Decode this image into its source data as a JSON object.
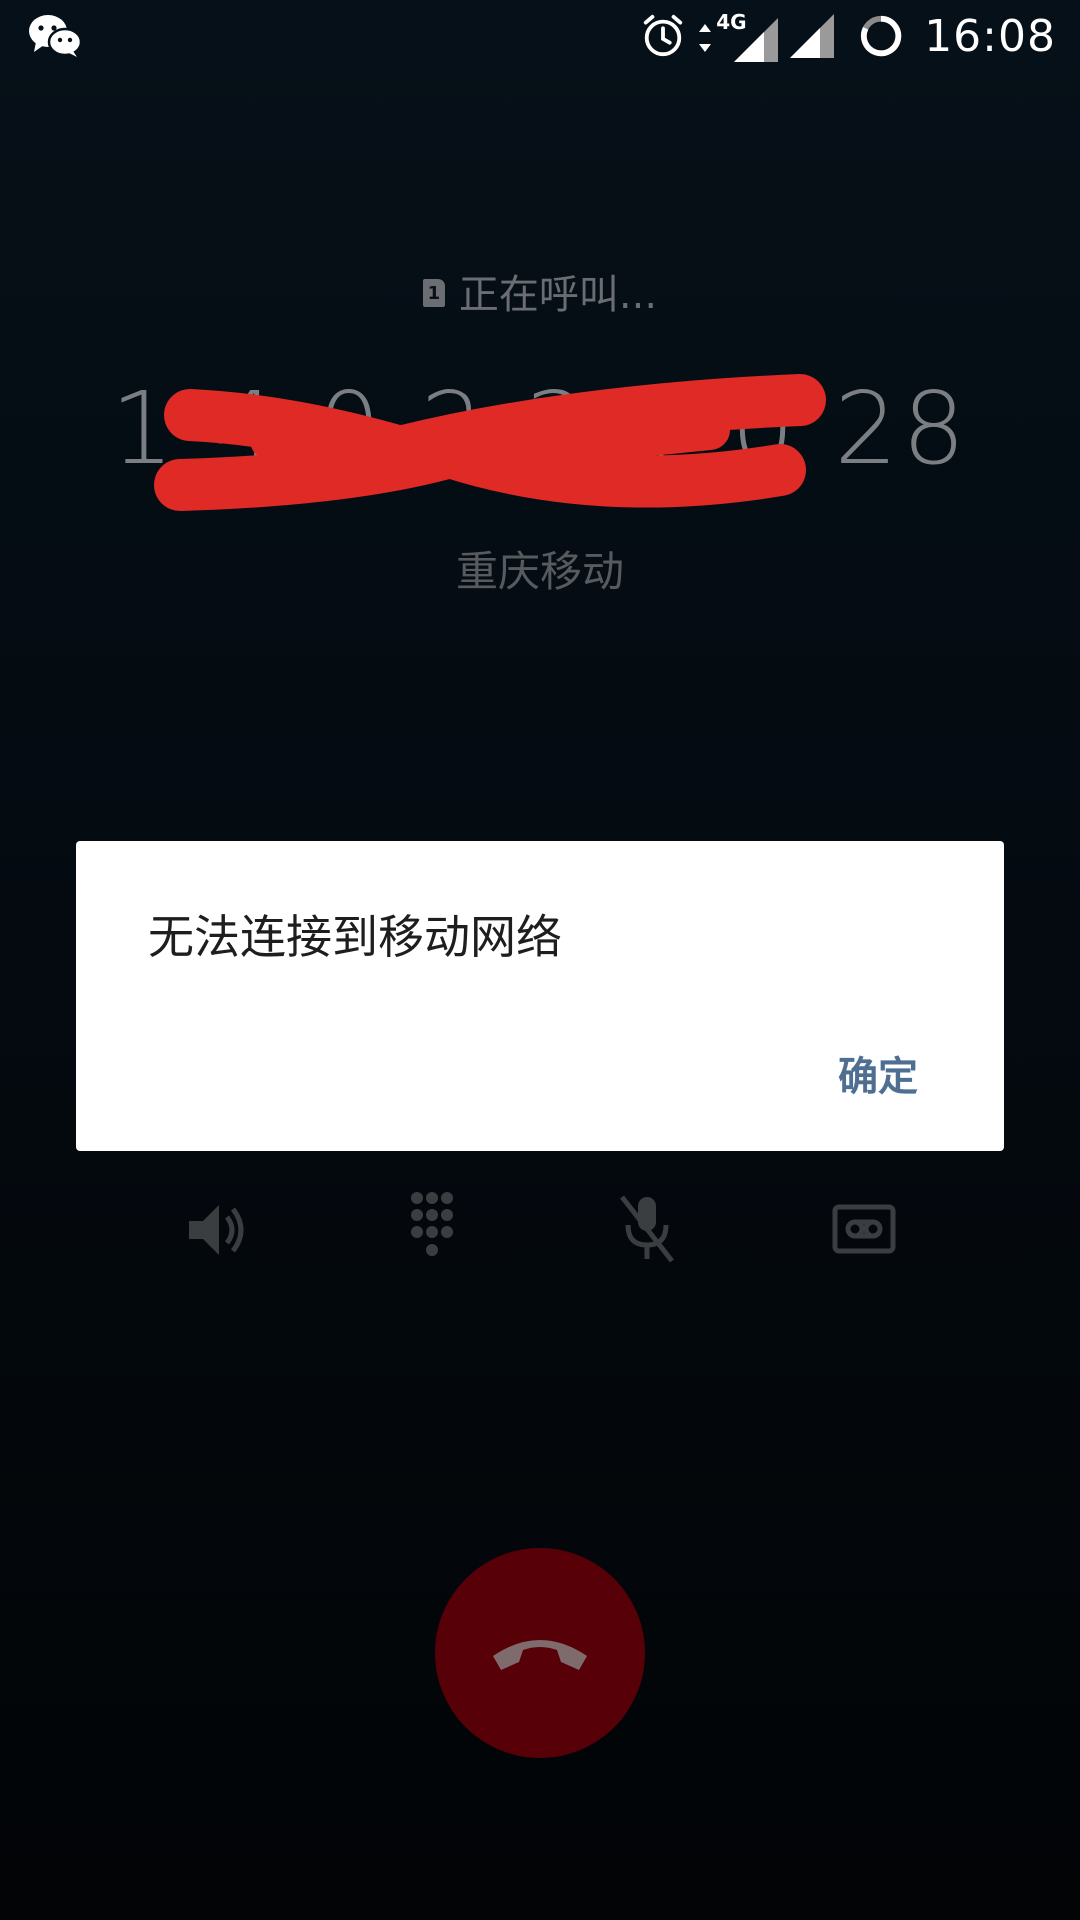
{
  "status_bar": {
    "time": "16:08",
    "network_label": "4G",
    "icons": [
      "wechat-icon",
      "alarm-icon",
      "data-arrows-icon",
      "signal-sim1-icon",
      "signal-sim2-icon",
      "battery-ring-icon"
    ]
  },
  "call": {
    "status_text": "正在呼叫...",
    "sim_label": "1",
    "number_display": "1  4  0 2 3 1  0 28",
    "carrier": "重庆移动"
  },
  "controls": [
    "speaker-icon",
    "dialpad-icon",
    "mute-icon",
    "record-icon"
  ],
  "dialog": {
    "message": "无法连接到移动网络",
    "ok_label": "确定"
  },
  "colors": {
    "end_call_bg": "#570008",
    "dialog_button": "#4f6f92",
    "redaction": "#e02a26"
  }
}
